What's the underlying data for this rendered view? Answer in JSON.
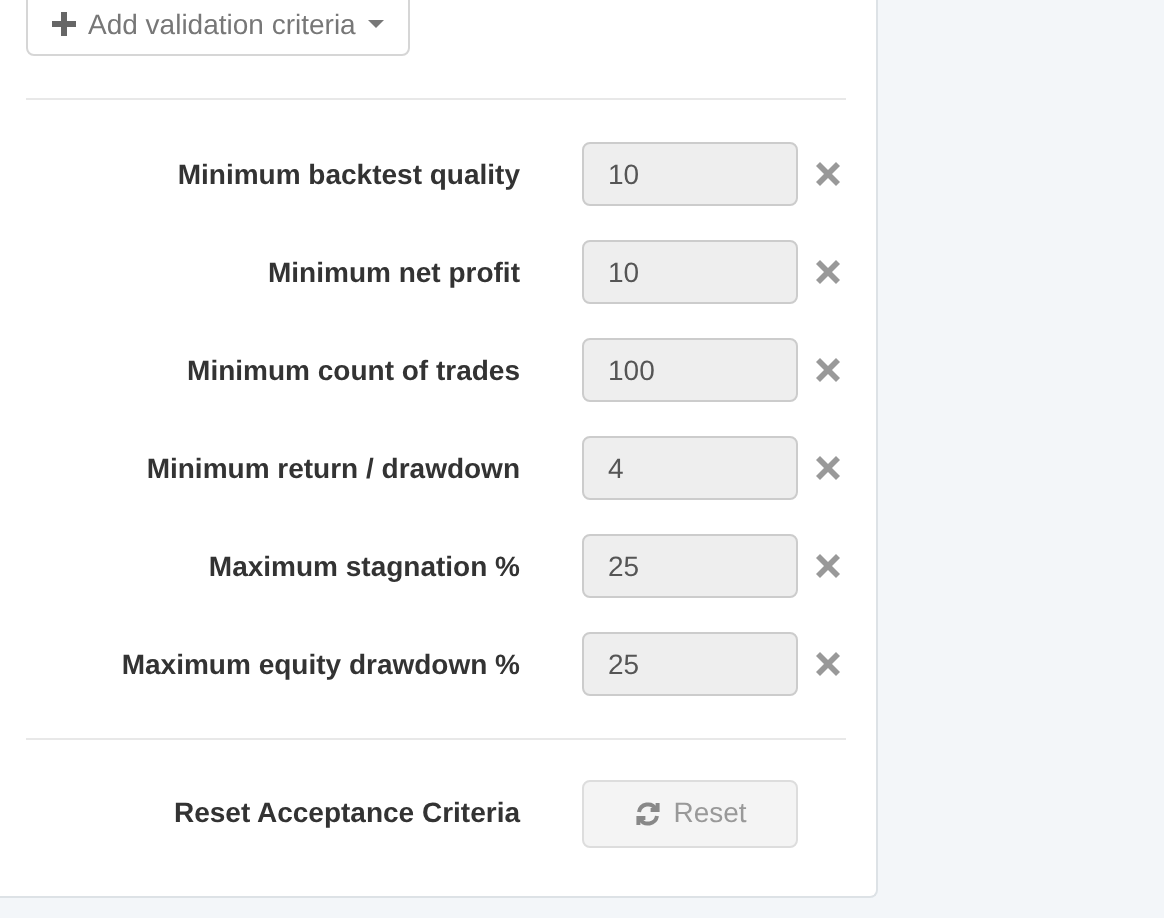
{
  "add_button": {
    "label": "Add validation criteria"
  },
  "criteria": [
    {
      "label": "Minimum backtest quality",
      "value": "10"
    },
    {
      "label": "Minimum net profit",
      "value": "10"
    },
    {
      "label": "Minimum count of trades",
      "value": "100"
    },
    {
      "label": "Minimum return / drawdown",
      "value": "4"
    },
    {
      "label": "Maximum stagnation %",
      "value": "25"
    },
    {
      "label": "Maximum equity drawdown %",
      "value": "25"
    }
  ],
  "reset": {
    "label": "Reset Acceptance Criteria",
    "button": "Reset",
    "disabled": true
  }
}
